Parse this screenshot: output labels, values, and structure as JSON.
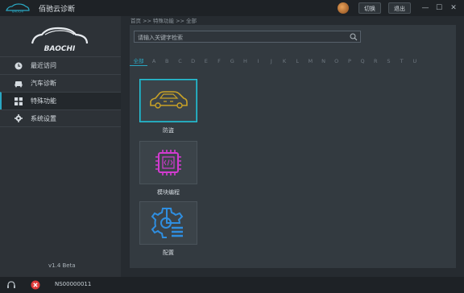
{
  "titlebar": {
    "app_title": "佰驰云诊断",
    "btn_switch": "切换",
    "btn_quit": "退出",
    "min": "—",
    "max": "☐",
    "close": "✕"
  },
  "sidebar": {
    "brand": "BAOCHI",
    "items": [
      {
        "label": "最近访问",
        "icon": "clock-icon"
      },
      {
        "label": "汽车诊断",
        "icon": "car-icon"
      },
      {
        "label": "特殊功能",
        "icon": "grid-icon",
        "active": true
      },
      {
        "label": "系统设置",
        "icon": "gear-icon"
      }
    ],
    "version": "v1.4 Beta"
  },
  "main": {
    "breadcrumb": "首页 >> 特殊功能 >> 全部",
    "search": {
      "placeholder": "请输入关键字检索"
    },
    "letters": [
      "全部",
      "A",
      "B",
      "C",
      "D",
      "E",
      "F",
      "G",
      "H",
      "I",
      "J",
      "K",
      "L",
      "M",
      "N",
      "O",
      "P",
      "Q",
      "R",
      "S",
      "T",
      "U"
    ],
    "tiles": [
      {
        "label": "防盗",
        "icon": "car-icon"
      },
      {
        "label": "模块编程",
        "icon": "chip-code-icon"
      },
      {
        "label": "配置",
        "icon": "gear-settings-icon"
      }
    ]
  },
  "statusbar": {
    "serial": "NS00000011"
  },
  "colors": {
    "accent": "#2aa7c2",
    "tile_car": "#c9a227",
    "tile_chip": "#d33bd0",
    "tile_gear": "#2f8ee0",
    "error": "#e03b3b"
  }
}
